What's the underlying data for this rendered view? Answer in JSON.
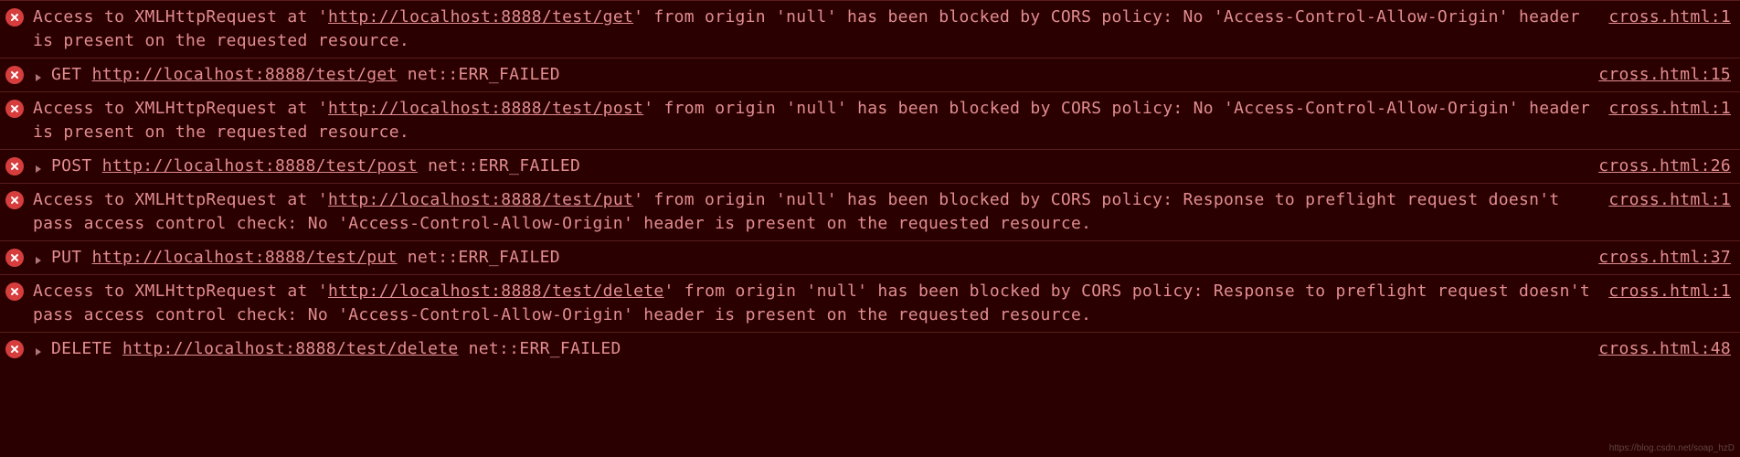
{
  "source": {
    "file": "cross.html"
  },
  "entries": [
    {
      "type": "cors",
      "prefix": "Access to XMLHttpRequest at '",
      "url": "http://localhost:8888/test/get",
      "mid": "' from origin 'null' has been blocked by CORS policy: No 'Access-Control-Allow-Origin' header is present on the requested resource.",
      "line": 1
    },
    {
      "type": "net",
      "method": "GET",
      "url": "http://localhost:8888/test/get",
      "suffix": " net::ERR_FAILED",
      "line": 15
    },
    {
      "type": "cors",
      "prefix": "Access to XMLHttpRequest at '",
      "url": "http://localhost:8888/test/post",
      "mid": "' from origin 'null' has been blocked by CORS policy: No 'Access-Control-Allow-Origin' header is present on the requested resource.",
      "line": 1
    },
    {
      "type": "net",
      "method": "POST",
      "url": "http://localhost:8888/test/post",
      "suffix": " net::ERR_FAILED",
      "line": 26
    },
    {
      "type": "cors",
      "prefix": "Access to XMLHttpRequest at '",
      "url": "http://localhost:8888/test/put",
      "mid": "' from origin 'null' has been blocked by CORS policy: Response to preflight request doesn't pass access control check: No 'Access-Control-Allow-Origin' header is present on the requested resource.",
      "line": 1
    },
    {
      "type": "net",
      "method": "PUT",
      "url": "http://localhost:8888/test/put",
      "suffix": " net::ERR_FAILED",
      "line": 37
    },
    {
      "type": "cors",
      "prefix": "Access to XMLHttpRequest at '",
      "url": "http://localhost:8888/test/delete",
      "mid": "' from origin 'null' has been blocked by CORS policy: Response to preflight request doesn't pass access control check: No 'Access-Control-Allow-Origin' header is present on the requested resource.",
      "line": 1
    },
    {
      "type": "net",
      "method": "DELETE",
      "url": "http://localhost:8888/test/delete",
      "suffix": " net::ERR_FAILED",
      "line": 48
    }
  ],
  "watermark": "https://blog.csdn.net/soap_hzD"
}
